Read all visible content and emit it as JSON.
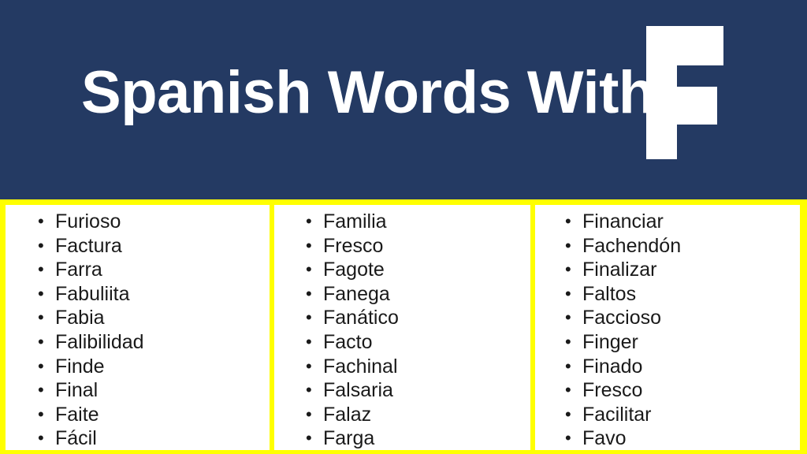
{
  "header": {
    "title": "Spanish Words With",
    "big_letter": "F",
    "background_color": "#243a63",
    "text_color": "#ffffff"
  },
  "card": {
    "border_color": "#ffff00",
    "background_color": "#ffffff",
    "bullet_glyph": "•",
    "columns": [
      {
        "name": "column-1",
        "words": [
          "Furioso",
          "Factura",
          "Farra",
          "Fabuliita",
          "Fabia",
          "Falibilidad",
          "Finde",
          "Final",
          "Faite",
          "Fácil"
        ]
      },
      {
        "name": "column-2",
        "words": [
          "Familia",
          "Fresco",
          "Fagote",
          "Fanega",
          "Fanático",
          "Facto",
          "Fachinal",
          "Falsaria",
          "Falaz",
          "Farga"
        ]
      },
      {
        "name": "column-3",
        "words": [
          "Financiar",
          "Fachendón",
          "Finalizar",
          "Faltos",
          "Faccioso",
          "Finger",
          "Finado",
          "Fresco",
          "Facilitar",
          "Favo"
        ]
      }
    ]
  }
}
